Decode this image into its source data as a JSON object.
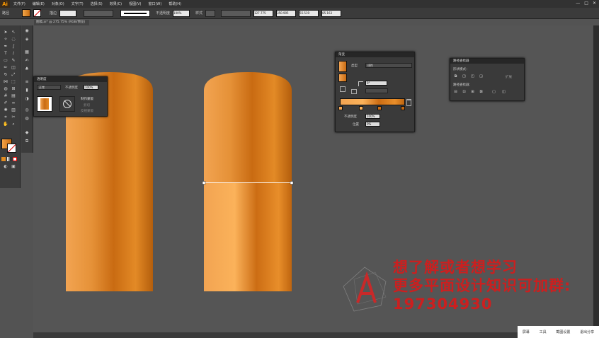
{
  "app": {
    "logo": "Ai",
    "window_buttons": [
      "—",
      "□",
      "✕"
    ]
  },
  "menu": [
    "文件(F)",
    "编辑(E)",
    "对象(O)",
    "文字(T)",
    "选择(S)",
    "效果(C)",
    "视图(V)",
    "窗口(W)",
    "帮助(H)"
  ],
  "control_bar": {
    "selection_label": "路径",
    "stroke_label": "描边",
    "opacity_label": "不透明度",
    "opacity_value": "100%",
    "style_label": "样式",
    "x_value": "127.775",
    "y_value": "350.905",
    "w_value": "55.519",
    "h_value": "85.163"
  },
  "document_tab": "图稿.ai* @ 275.75% (RGB/预览)",
  "gradient_panel": {
    "title": "渐变",
    "type_label": "类型",
    "type_value": "线性",
    "angle_value": "0°",
    "opacity_label": "不透明度",
    "opacity_value": "100%",
    "location_label": "位置",
    "location_value": "0%"
  },
  "transparency_panel": {
    "title": "透明度",
    "blend_mode": "正常",
    "opacity_label": "不透明度",
    "opacity_value": "100%",
    "make_mask": "制作蒙版",
    "clip": "剪切",
    "invert_mask": "反相蒙版"
  },
  "pathfinder_panel": {
    "title": "路径查找器",
    "shape_modes": "形状模式：",
    "expand": "扩展",
    "pathfinders": "路径查找器："
  },
  "watermark": {
    "line1": "想了解或者想学习",
    "line2": "更多平面设计知识可加群:",
    "line3": "197304930"
  },
  "taskbar": [
    "屏幕",
    "工具",
    "截图设置",
    "退出分享"
  ],
  "colors": {
    "accent": "#e07a10",
    "watermark": "#cc1f1f",
    "ui_dark": "#3a3a3a",
    "canvas": "#555555"
  }
}
